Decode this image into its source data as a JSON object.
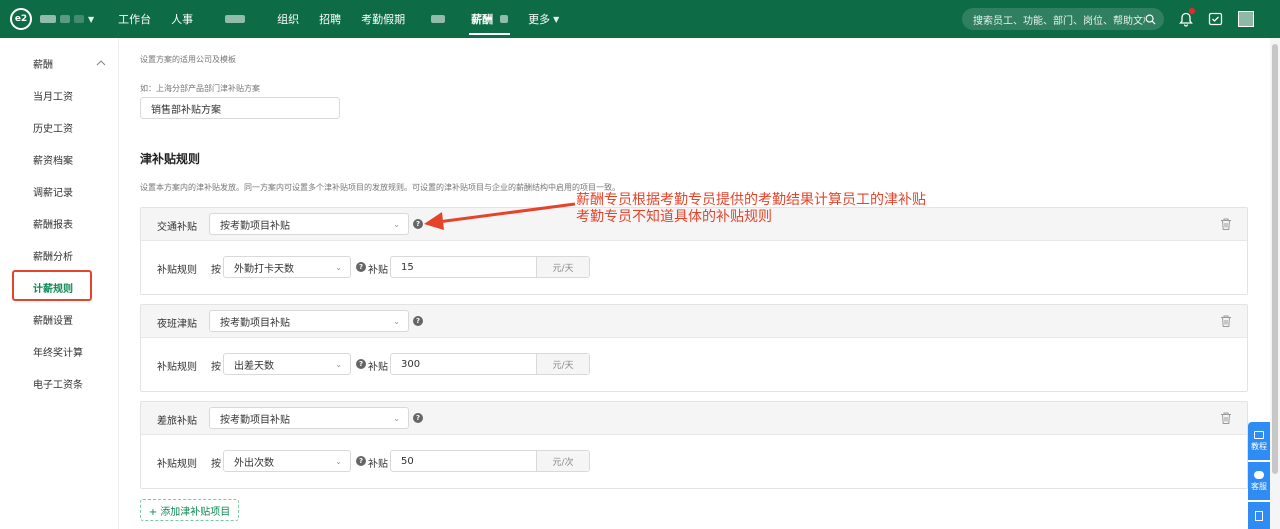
{
  "topbar": {
    "logo_text": "e2",
    "nav": [
      {
        "label": "工作台"
      },
      {
        "label": "人事"
      },
      {
        "label": ""
      },
      {
        "label": "组织"
      },
      {
        "label": "招聘"
      },
      {
        "label": "考勤假期"
      },
      {
        "label": ""
      },
      {
        "label": "薪酬",
        "active": true
      },
      {
        "label": "更多"
      }
    ],
    "search_placeholder": "搜索员工、功能、部门、岗位、帮助文档"
  },
  "sidebar": {
    "group_label": "薪酬",
    "items": [
      "当月工资",
      "历史工资",
      "薪资档案",
      "调薪记录",
      "薪酬报表",
      "薪酬分析",
      "计薪规则",
      "薪酬设置",
      "年终奖计算",
      "电子工资条"
    ],
    "active": "计薪规则"
  },
  "main": {
    "scope_hint": "设置方案的适用公司及模板",
    "name_hint": "如：上海分部产品部门津补贴方案",
    "name_value": "销售部补贴方案",
    "rules_title": "津补贴规则",
    "rules_desc": "设置本方案内的津补贴发放。同一方案内可设置多个津补贴项目的发放规则。可设置的津补贴项目与企业的薪酬结构中启用的项目一致。",
    "rule_label": "补贴规则",
    "by_label": "按",
    "subsidy_label": "补贴",
    "cards": [
      {
        "name": "交通补贴",
        "mode": "按考勤项目补贴",
        "basis": "外勤打卡天数",
        "amount": "15",
        "unit": "元/天"
      },
      {
        "name": "夜班津贴",
        "mode": "按考勤项目补贴",
        "basis": "出差天数",
        "amount": "300",
        "unit": "元/天"
      },
      {
        "name": "差旅补贴",
        "mode": "按考勤项目补贴",
        "basis": "外出次数",
        "amount": "50",
        "unit": "元/次"
      }
    ],
    "add_button": "+ 添加津补贴项目"
  },
  "annotation": {
    "line1": "薪酬专员根据考勤专员提供的考勤结果计算员工的津补贴",
    "line2": "考勤专员不知道具体的补贴规则",
    "color": "#e5442b"
  },
  "float_tabs": [
    "教程",
    "客服"
  ],
  "colors": {
    "brand": "#0d6b46",
    "accent": "#0d8a55",
    "annotation": "#e5442b"
  }
}
